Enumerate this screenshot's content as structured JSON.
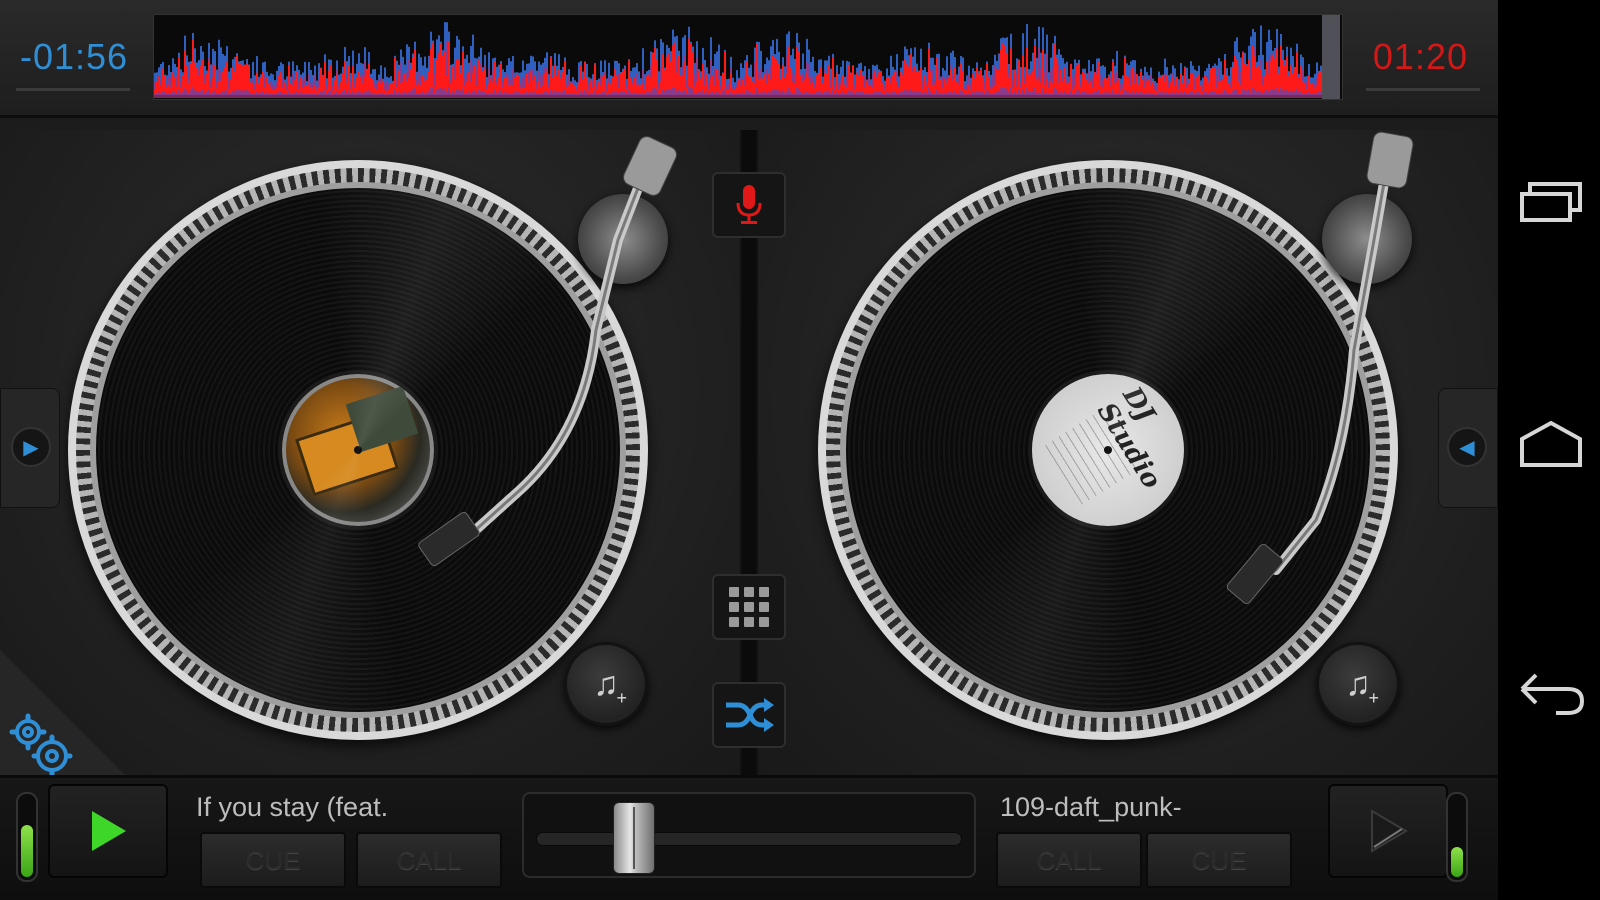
{
  "header": {
    "time_elapsed_left": "-01:56",
    "time_right": "01:20"
  },
  "deck_left": {
    "track_title": "If you stay (feat.",
    "cue_label": "CUE",
    "call_label": "CALL",
    "level": 0.6
  },
  "deck_right": {
    "track_title": "109-daft_punk-",
    "call_label": "CALL",
    "cue_label": "CUE",
    "label_text": "DJ Studio",
    "level": 0.35
  },
  "crossfader": {
    "position": 0.2
  },
  "icons": {
    "mic": "microphone-icon",
    "grid": "grid-icon",
    "shuffle": "shuffle-icon",
    "settings": "gears-icon",
    "add_music": "music-note-plus-icon",
    "play": "play-icon",
    "recents": "recent-apps-icon",
    "home": "home-icon",
    "back": "back-icon"
  },
  "colors": {
    "accent_blue": "#2f8fd6",
    "accent_red": "#d41717",
    "play_green": "#3fd62a",
    "waveform_red": "#ff1a1a",
    "waveform_blue": "#2f5fbf",
    "waveform_purple": "#8a3a8a"
  }
}
